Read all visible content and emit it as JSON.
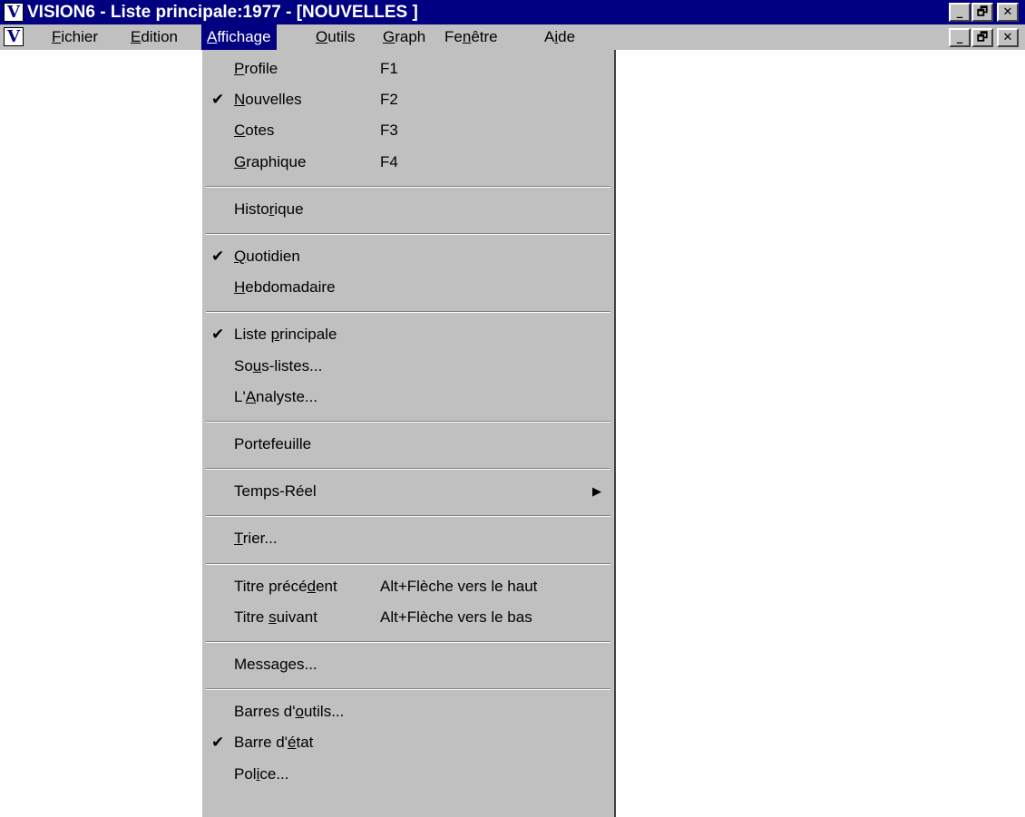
{
  "window": {
    "title": "VISION6 - Liste principale:1977 - [NOUVELLES ]",
    "app_icon": "V",
    "buttons": {
      "minimize": "_",
      "restore": "🗗",
      "close": "✕"
    }
  },
  "menubar": {
    "items": [
      {
        "label": "Fichier",
        "underline": "F"
      },
      {
        "label": "Edition",
        "underline": "E"
      },
      {
        "label": "Affichage",
        "underline": "A"
      },
      {
        "label": "Outils",
        "underline": "O"
      },
      {
        "label": "Graph",
        "underline": "G"
      },
      {
        "label": "Fenêtre",
        "underline": "n"
      },
      {
        "label": "Aide",
        "underline": "i"
      }
    ]
  },
  "dropdown": {
    "groups": [
      [
        {
          "pre": "",
          "u": "P",
          "post": "rofile",
          "shortcut": "F1",
          "checked": false
        },
        {
          "pre": "",
          "u": "N",
          "post": "ouvelles",
          "shortcut": "F2",
          "checked": true
        },
        {
          "pre": "",
          "u": "C",
          "post": "otes",
          "shortcut": "F3",
          "checked": false
        },
        {
          "pre": "",
          "u": "G",
          "post": "raphique",
          "shortcut": "F4",
          "checked": false
        }
      ],
      [
        {
          "pre": "Histo",
          "u": "r",
          "post": "ique",
          "shortcut": "",
          "checked": false
        }
      ],
      [
        {
          "pre": "",
          "u": "Q",
          "post": "uotidien",
          "shortcut": "",
          "checked": true
        },
        {
          "pre": "",
          "u": "H",
          "post": "ebdomadaire",
          "shortcut": "",
          "checked": false
        }
      ],
      [
        {
          "pre": "Liste ",
          "u": "p",
          "post": "rincipale",
          "shortcut": "",
          "checked": true
        },
        {
          "pre": "So",
          "u": "u",
          "post": "s-listes...",
          "shortcut": "",
          "checked": false
        },
        {
          "pre": "L'",
          "u": "A",
          "post": "nalyste...",
          "shortcut": "",
          "checked": false
        }
      ],
      [
        {
          "pre": "Portefeuille",
          "u": "",
          "post": "",
          "shortcut": "",
          "checked": false
        }
      ],
      [
        {
          "pre": "Temps-Réel",
          "u": "",
          "post": "",
          "shortcut": "",
          "checked": false,
          "submenu": true
        }
      ],
      [
        {
          "pre": "",
          "u": "T",
          "post": "rier...",
          "shortcut": "",
          "checked": false
        }
      ],
      [
        {
          "pre": "Titre précé",
          "u": "d",
          "post": "ent",
          "shortcut": "Alt+Flèche vers le haut",
          "checked": false
        },
        {
          "pre": "Titre ",
          "u": "s",
          "post": "uivant",
          "shortcut": "Alt+Flèche vers le bas",
          "checked": false
        }
      ],
      [
        {
          "pre": "Messages...",
          "u": "",
          "post": "",
          "shortcut": "",
          "checked": false
        }
      ],
      [
        {
          "pre": "Barres d'",
          "u": "o",
          "post": "utils...",
          "shortcut": "",
          "checked": false
        },
        {
          "pre": "Barre d'",
          "u": "é",
          "post": "tat",
          "shortcut": "",
          "checked": true
        },
        {
          "pre": "Pol",
          "u": "i",
          "post": "ce...",
          "shortcut": "",
          "checked": false
        }
      ]
    ],
    "check_glyph": "✔",
    "submenu_glyph": "▶"
  }
}
